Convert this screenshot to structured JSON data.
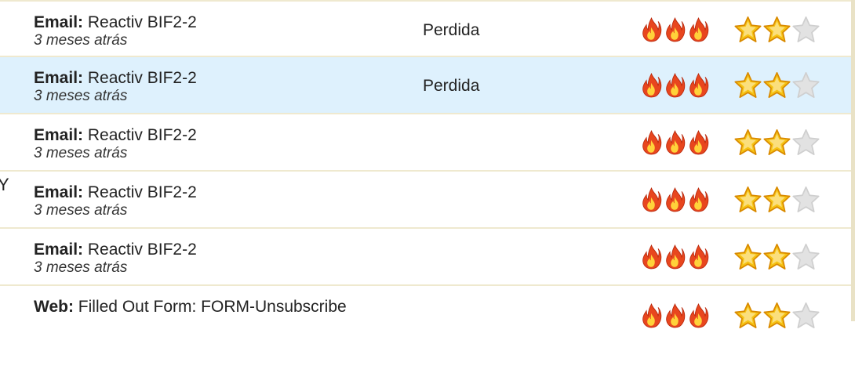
{
  "rows": [
    {
      "type": "Email:",
      "subject": "Reactiv BIF2-2",
      "time": "3 meses atrás",
      "status": "Perdida",
      "score_level": 3,
      "rating": 2,
      "rating_max": 3
    },
    {
      "type": "Email:",
      "subject": "Reactiv BIF2-2",
      "time": "3 meses atrás",
      "status": "Perdida",
      "score_level": 3,
      "rating": 2,
      "rating_max": 3,
      "highlighted": true
    },
    {
      "type": "Email:",
      "subject": "Reactiv BIF2-2",
      "time": "3 meses atrás",
      "status": "",
      "score_level": 3,
      "rating": 2,
      "rating_max": 3
    },
    {
      "type": "Email:",
      "subject": "Reactiv BIF2-2",
      "time": "3 meses atrás",
      "status": "",
      "score_level": 3,
      "rating": 2,
      "rating_max": 3
    },
    {
      "type": "Email:",
      "subject": "Reactiv BIF2-2",
      "time": "3 meses atrás",
      "status": "",
      "score_level": 3,
      "rating": 2,
      "rating_max": 3
    },
    {
      "type": "Web:",
      "subject": "Filled Out Form: FORM-Unsubscribe",
      "time": "",
      "status": "",
      "score_level": 3,
      "rating": 2,
      "rating_max": 3
    }
  ],
  "left_edge_glyph": "Y",
  "colors": {
    "row_border": "#efe9cf",
    "highlight": "#def1fd",
    "flame": "#e8461e",
    "star_fill": "#f6c313",
    "star_empty": "#e2e2e2"
  },
  "icons": {
    "score": "flame-icon",
    "rating_filled": "star-filled-icon",
    "rating_empty": "star-empty-icon"
  }
}
